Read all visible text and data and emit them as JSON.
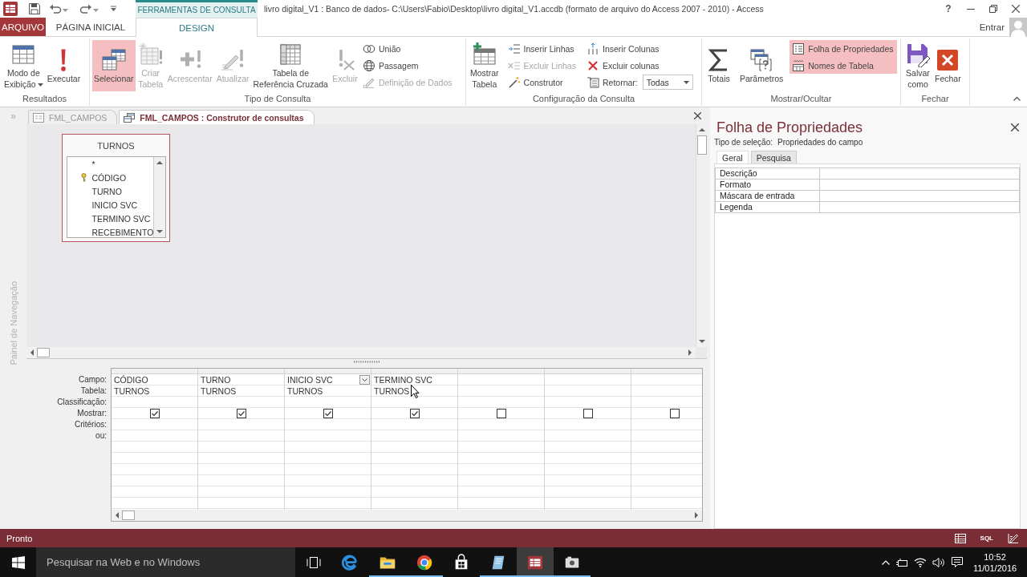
{
  "title_bar": {
    "context_label": "FERRAMENTAS DE CONSULTA",
    "title": "livro digital_V1 : Banco de dados- C:\\Users\\Fabio\\Desktop\\livro digital_V1.accdb (formato de arquivo do Access 2007 - 2010) - Access",
    "help": "?"
  },
  "ribbon_tabs": [
    {
      "kind": "file",
      "label": "ARQUIVO",
      "selected": false
    },
    {
      "kind": "tab",
      "label": "PÁGINA INICIAL",
      "selected": false
    },
    {
      "kind": "context",
      "label": "DESIGN",
      "selected": true
    }
  ],
  "account": {
    "label": "Entrar"
  },
  "ribbon_groups": [
    {
      "label": "Resultados",
      "items": [
        {
          "kind": "large",
          "label": "Modo de\nExibição",
          "dropdown": true,
          "pressed": false,
          "disabled": false
        },
        {
          "kind": "large",
          "label": "Executar",
          "dropdown": false,
          "pressed": false,
          "disabled": false
        }
      ]
    },
    {
      "label": "Tipo de Consulta",
      "items": [
        {
          "kind": "large",
          "label": "Selecionar",
          "dropdown": false,
          "pressed": true,
          "disabled": false
        },
        {
          "kind": "large",
          "label": "Criar\nTabela",
          "dropdown": false,
          "pressed": false,
          "disabled": true
        },
        {
          "kind": "large",
          "label": "Acrescentar",
          "dropdown": false,
          "pressed": false,
          "disabled": true
        },
        {
          "kind": "large",
          "label": "Atualizar",
          "dropdown": false,
          "pressed": false,
          "disabled": true
        },
        {
          "kind": "large",
          "label": "Tabela de\nReferência Cruzada",
          "dropdown": false,
          "pressed": false,
          "disabled": false
        },
        {
          "kind": "large",
          "label": "Excluir",
          "dropdown": false,
          "pressed": false,
          "disabled": true
        },
        {
          "kind": "stack",
          "items": [
            {
              "kind": "small",
              "label": "União",
              "pressed": false,
              "disabled": false
            },
            {
              "kind": "small",
              "label": "Passagem",
              "pressed": false,
              "disabled": false
            },
            {
              "kind": "small",
              "label": "Definição de Dados",
              "pressed": false,
              "disabled": true
            }
          ]
        }
      ]
    },
    {
      "label": "Configuração da Consulta",
      "items": [
        {
          "kind": "large",
          "label": "Mostrar\nTabela",
          "dropdown": false,
          "pressed": false,
          "disabled": false
        },
        {
          "kind": "stack",
          "items": [
            {
              "kind": "small",
              "label": "Inserir Linhas",
              "pressed": false,
              "disabled": false
            },
            {
              "kind": "small",
              "label": "Excluir Linhas",
              "pressed": false,
              "disabled": true
            },
            {
              "kind": "small",
              "label": "Construtor",
              "pressed": false,
              "disabled": false
            }
          ]
        },
        {
          "kind": "stack",
          "items": [
            {
              "kind": "small",
              "label": "Inserir Colunas",
              "pressed": false,
              "disabled": false
            },
            {
              "kind": "small",
              "label": "Excluir colunas",
              "pressed": false,
              "disabled": false
            },
            {
              "kind": "combo",
              "label": "Retornar:",
              "value": "Todas"
            }
          ]
        }
      ]
    },
    {
      "label": "Mostrar/Ocultar",
      "items": [
        {
          "kind": "large",
          "label": "Totais",
          "dropdown": false,
          "pressed": false,
          "disabled": false
        },
        {
          "kind": "large",
          "label": "Parâmetros",
          "dropdown": false,
          "pressed": false,
          "disabled": false
        },
        {
          "kind": "stack",
          "items": [
            {
              "kind": "small",
              "label": "Folha de Propriedades",
              "pressed": true,
              "disabled": false
            },
            {
              "kind": "small",
              "label": "Nomes de Tabela",
              "pressed": true,
              "disabled": false
            }
          ]
        }
      ]
    },
    {
      "label": "Fechar",
      "items": [
        {
          "kind": "large",
          "label": "Salvar\ncomo",
          "dropdown": false,
          "pressed": false,
          "disabled": false
        },
        {
          "kind": "large",
          "label": "Fechar",
          "dropdown": false,
          "pressed": false,
          "disabled": false
        }
      ]
    }
  ],
  "nav_pane": {
    "toggle": "»",
    "label": "Painel de Navegação"
  },
  "document_tabs": [
    {
      "label": "FML_CAMPOS",
      "selected": false
    },
    {
      "label": "FML_CAMPOS : Construtor de consultas",
      "selected": true
    }
  ],
  "table_window": {
    "title": "TURNOS",
    "fields": [
      {
        "name": "*",
        "primary_key": false
      },
      {
        "name": "CÓDIGO",
        "primary_key": true
      },
      {
        "name": "TURNO",
        "primary_key": false
      },
      {
        "name": "INICIO SVC",
        "primary_key": false
      },
      {
        "name": "TERMINO SVC",
        "primary_key": false
      },
      {
        "name": "RECEBIMENTO",
        "primary_key": false
      }
    ]
  },
  "query_grid": {
    "row_labels": [
      "Campo:",
      "Tabela:",
      "Classificação:",
      "Mostrar:",
      "Critérios:",
      "ou:"
    ],
    "columns": [
      {
        "field": "CÓDIGO",
        "table": "TURNOS",
        "show": true,
        "active": false
      },
      {
        "field": "TURNO",
        "table": "TURNOS",
        "show": true,
        "active": false
      },
      {
        "field": "INICIO SVC",
        "table": "TURNOS",
        "show": true,
        "active": true
      },
      {
        "field": "TERMINO SVC",
        "table": "TURNOS",
        "show": true,
        "active": false
      },
      {
        "show": false,
        "active": false
      },
      {
        "show": false,
        "active": false
      },
      {
        "show": false,
        "active": false
      }
    ]
  },
  "property_sheet": {
    "title": "Folha de Propriedades",
    "selection_label": "Tipo de seleção:",
    "selection_value": "Propriedades do campo",
    "tabs": [
      {
        "label": "Geral",
        "selected": true
      },
      {
        "label": "Pesquisa",
        "selected": false
      }
    ],
    "properties": [
      {
        "label": "Descrição"
      },
      {
        "label": "Formato"
      },
      {
        "label": "Máscara de entrada"
      },
      {
        "label": "Legenda"
      }
    ]
  },
  "status_bar": {
    "text": "Pronto",
    "sql_label": "SQL"
  },
  "taskbar": {
    "search": {
      "placeholder": "Pesquisar na Web e no Windows"
    },
    "apps": [
      {
        "running": false,
        "selected": false
      },
      {
        "running": true,
        "selected": false
      },
      {
        "running": true,
        "selected": false
      },
      {
        "running": false,
        "selected": false
      },
      {
        "running": true,
        "selected": false
      },
      {
        "running": true,
        "selected": true
      },
      {
        "running": true,
        "selected": false
      }
    ],
    "time": "10:52",
    "date": "11/01/2016"
  }
}
